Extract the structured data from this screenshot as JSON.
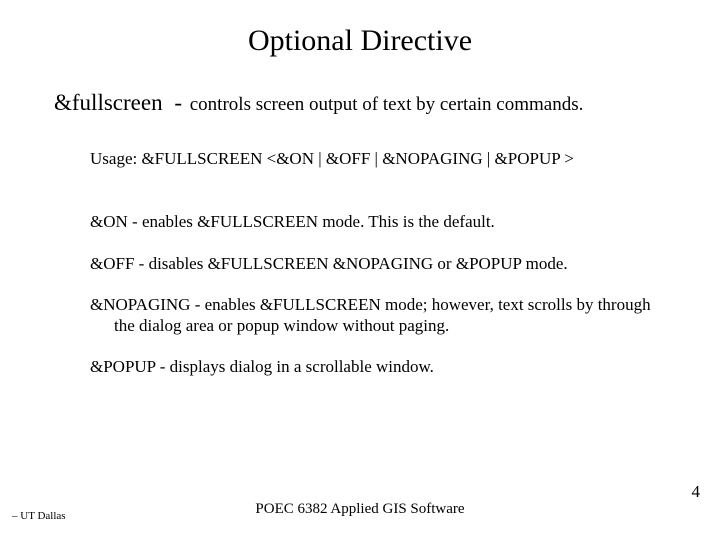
{
  "title": "Optional Directive",
  "directive": {
    "name": "&fullscreen",
    "dash": "-",
    "desc": "controls screen output of text by certain commands."
  },
  "usage": "Usage:  &FULLSCREEN <&ON | &OFF | &NOPAGING | &POPUP >",
  "params": [
    "&ON - enables &FULLSCREEN mode.  This is the default.",
    "&OFF - disables &FULLSCREEN &NOPAGING or &POPUP mode.",
    "&NOPAGING - enables &FULLSCREEN mode; however, text scrolls by through the dialog area or popup window without paging.",
    "&POPUP - displays dialog in a scrollable window."
  ],
  "footer": {
    "left": "– UT Dallas",
    "center": "POEC 6382 Applied GIS Software",
    "page": "4"
  }
}
